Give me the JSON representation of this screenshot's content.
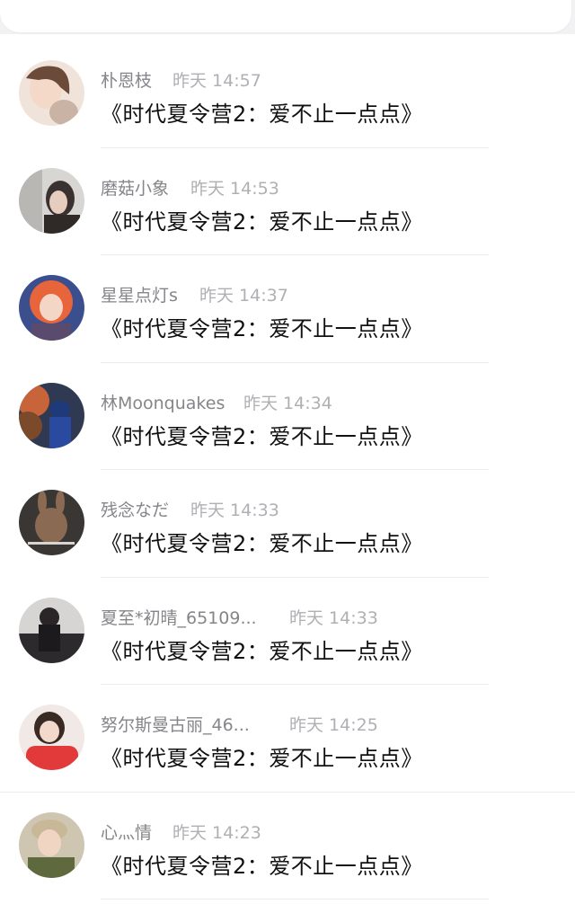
{
  "header": {
    "back_icon": "chevron-left-icon",
    "accent": "#3d8ef0"
  },
  "comments": [
    {
      "user": "朴恩枝",
      "time": "昨天 14:57",
      "message": "《时代夏令营2：爱不止一点点》"
    },
    {
      "user": "磨菇小象",
      "time": "昨天 14:53",
      "message": "《时代夏令营2：爱不止一点点》"
    },
    {
      "user": "星星点灯s",
      "time": "昨天 14:37",
      "message": "《时代夏令营2：爱不止一点点》"
    },
    {
      "user": "林Moonquakes",
      "time": "昨天 14:34",
      "message": "《时代夏令营2：爱不止一点点》"
    },
    {
      "user": "残念なだ",
      "time": "昨天 14:33",
      "message": "《时代夏令营2：爱不止一点点》"
    },
    {
      "user": "夏至*初晴_65109...",
      "time": "昨天 14:33",
      "message": "《时代夏令营2：爱不止一点点》"
    },
    {
      "user": "努尔斯曼古丽_46...",
      "time": "昨天 14:25",
      "message": "《时代夏令营2：爱不止一点点》"
    },
    {
      "user": "心灬情",
      "time": "昨天 14:23",
      "message": "《时代夏令营2：爱不止一点点》"
    }
  ]
}
